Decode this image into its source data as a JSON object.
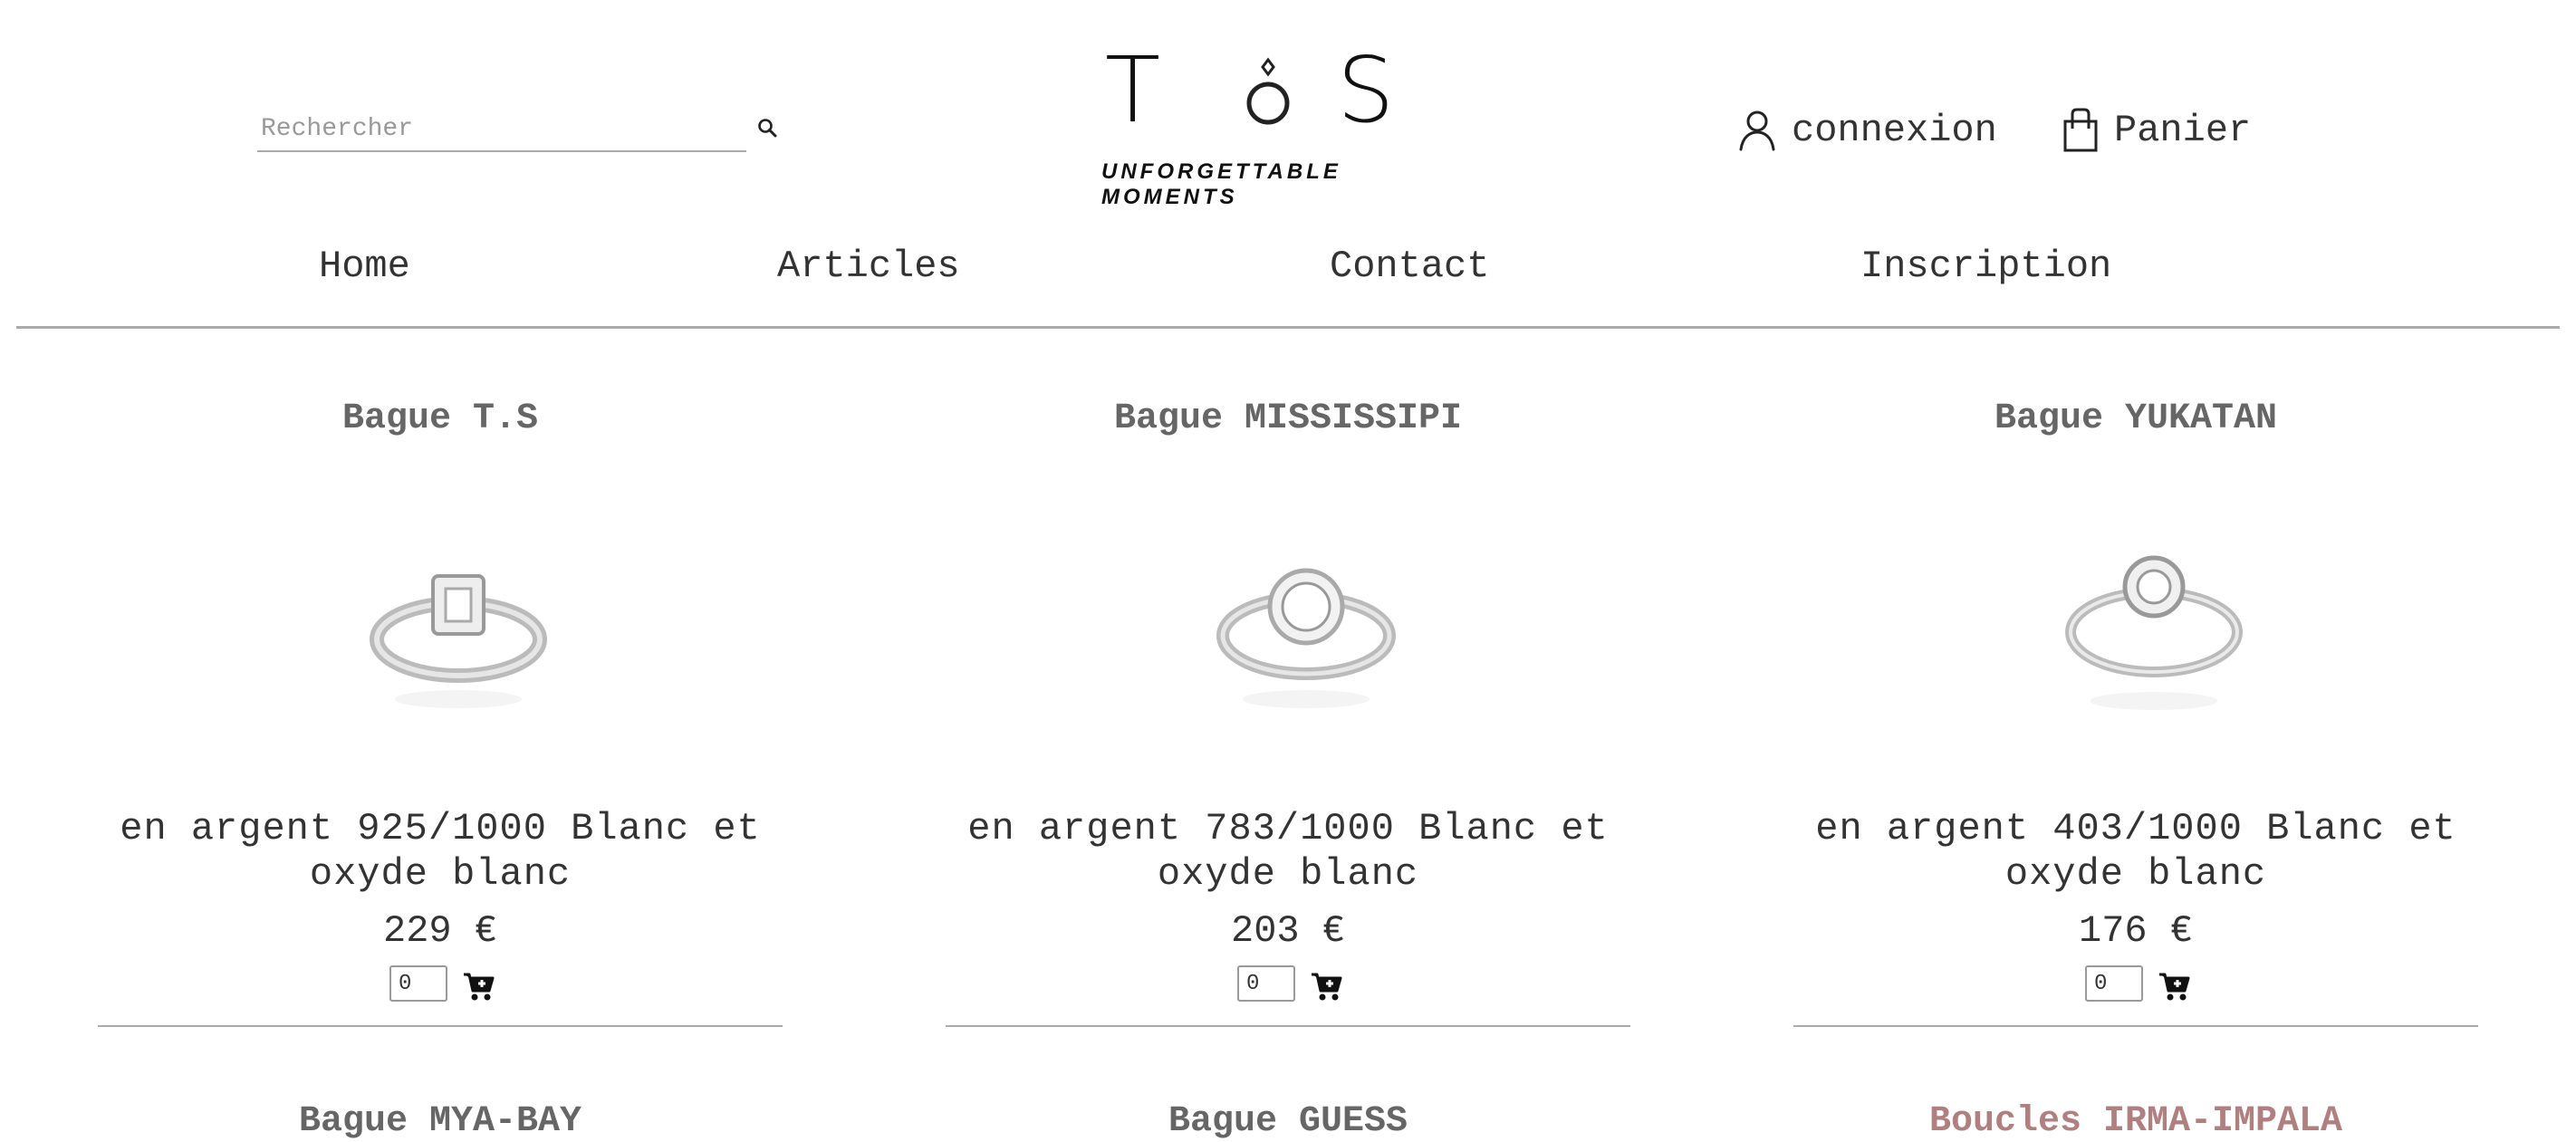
{
  "header": {
    "search": {
      "placeholder": "Rechercher",
      "value": ""
    },
    "logo": {
      "left_letter": "T",
      "right_letter": "S",
      "tagline": "UNFORGETTABLE MOMENTS"
    },
    "login_label": "connexion",
    "cart_label": "Panier"
  },
  "nav": {
    "items": [
      {
        "label": "Home"
      },
      {
        "label": "Articles"
      },
      {
        "label": "Contact"
      },
      {
        "label": "Inscription"
      }
    ]
  },
  "products": [
    {
      "name": "Bague T.S",
      "description": "en argent 925/1000 Blanc et oxyde blanc",
      "price": "229 €",
      "quantity": "0"
    },
    {
      "name": "Bague MISSISSIPI",
      "description": "en argent 783/1000 Blanc et oxyde blanc",
      "price": "203 €",
      "quantity": "0"
    },
    {
      "name": "Bague YUKATAN",
      "description": "en argent 403/1000 Blanc et oxyde blanc",
      "price": "176 €",
      "quantity": "0"
    }
  ],
  "next_row": [
    {
      "name": "Bague MYA-BAY"
    },
    {
      "name": "Bague GUESS"
    },
    {
      "name": "Boucles IRMA-IMPALA"
    }
  ],
  "colors": {
    "accent_pink": "#b08080",
    "heading_gray": "#666666",
    "rule_gray": "#aaaaaa"
  },
  "icons": [
    "search-icon",
    "user-icon",
    "shopping-bag-icon",
    "add-to-cart-icon",
    "ring-icon"
  ]
}
